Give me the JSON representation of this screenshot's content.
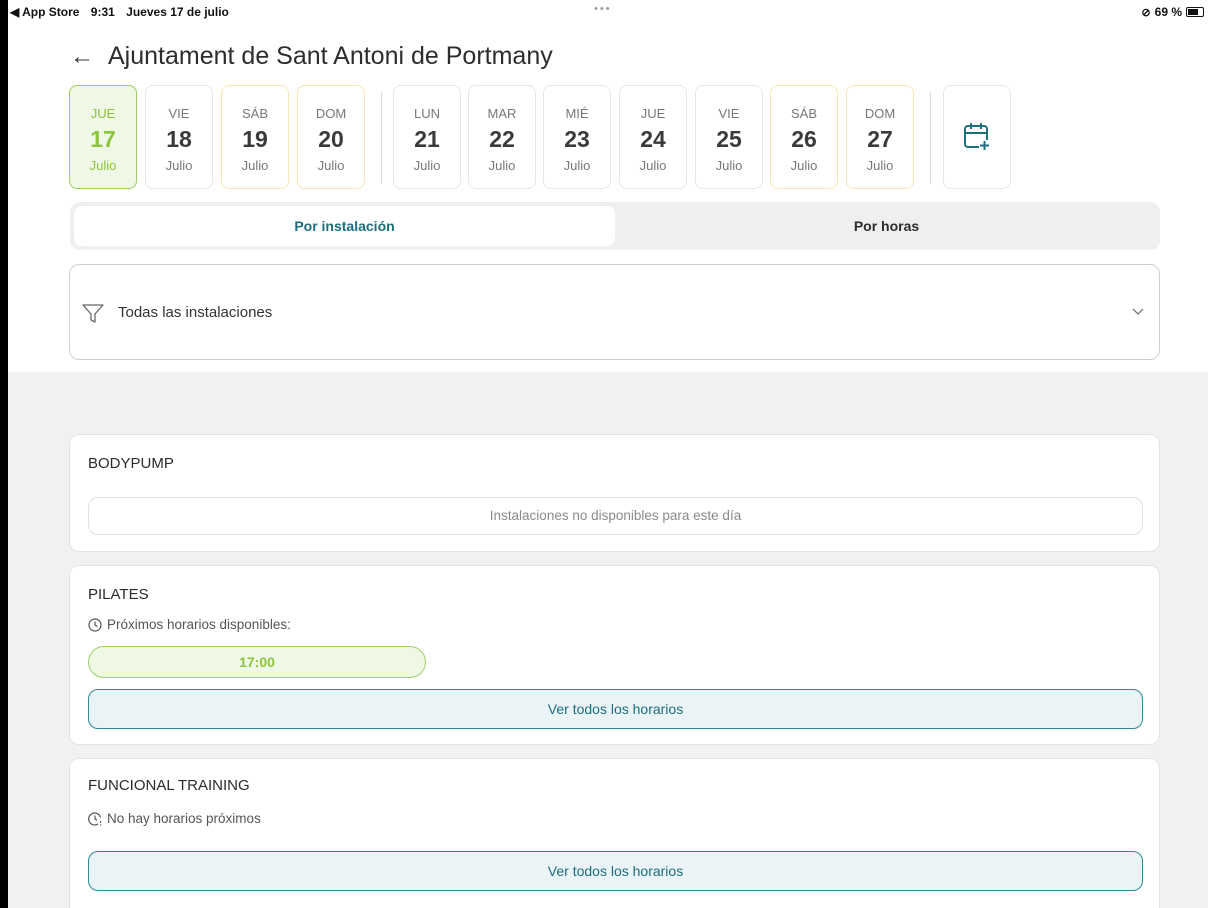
{
  "status_bar": {
    "back_app": "◀ App Store",
    "time": "9:31",
    "date": "Jueves 17 de julio",
    "dots": "•••",
    "rotation_lock": "⊘",
    "battery": "69 %"
  },
  "header": {
    "back_arrow": "←",
    "title": "Ajuntament de Sant Antoni de Portmany"
  },
  "days": [
    {
      "weekday": "JUE",
      "day": "17",
      "month": "Julio"
    },
    {
      "weekday": "VIE",
      "day": "18",
      "month": "Julio"
    },
    {
      "weekday": "SÁB",
      "day": "19",
      "month": "Julio"
    },
    {
      "weekday": "DOM",
      "day": "20",
      "month": "Julio"
    },
    {
      "weekday": "LUN",
      "day": "21",
      "month": "Julio"
    },
    {
      "weekday": "MAR",
      "day": "22",
      "month": "Julio"
    },
    {
      "weekday": "MIÉ",
      "day": "23",
      "month": "Julio"
    },
    {
      "weekday": "JUE",
      "day": "24",
      "month": "Julio"
    },
    {
      "weekday": "VIE",
      "day": "25",
      "month": "Julio"
    },
    {
      "weekday": "SÁB",
      "day": "26",
      "month": "Julio"
    },
    {
      "weekday": "DOM",
      "day": "27",
      "month": "Julio"
    }
  ],
  "calendar_icon": "calendar-plus-icon",
  "tabs": {
    "by_facility": "Por instalación",
    "by_hours": "Por horas"
  },
  "filter": {
    "label": "Todas las instalaciones",
    "icon": "funnel-icon"
  },
  "cards": {
    "bodypump": {
      "name": "BODYPUMP",
      "unavailable": "Instalaciones no disponibles para este día"
    },
    "pilates": {
      "name": "PILATES",
      "next_label": "Próximos horarios disponibles:",
      "slot": "17:00",
      "all_button": "Ver todos los horarios"
    },
    "functional": {
      "name": "FUNCIONAL TRAINING",
      "none_label": "No hay horarios próximos",
      "all_button": "Ver todos los horarios"
    }
  },
  "colors": {
    "selected_green": "#8cc43c",
    "accent_teal": "#1b6e7e",
    "weekend_border": "#f4e7b6"
  }
}
